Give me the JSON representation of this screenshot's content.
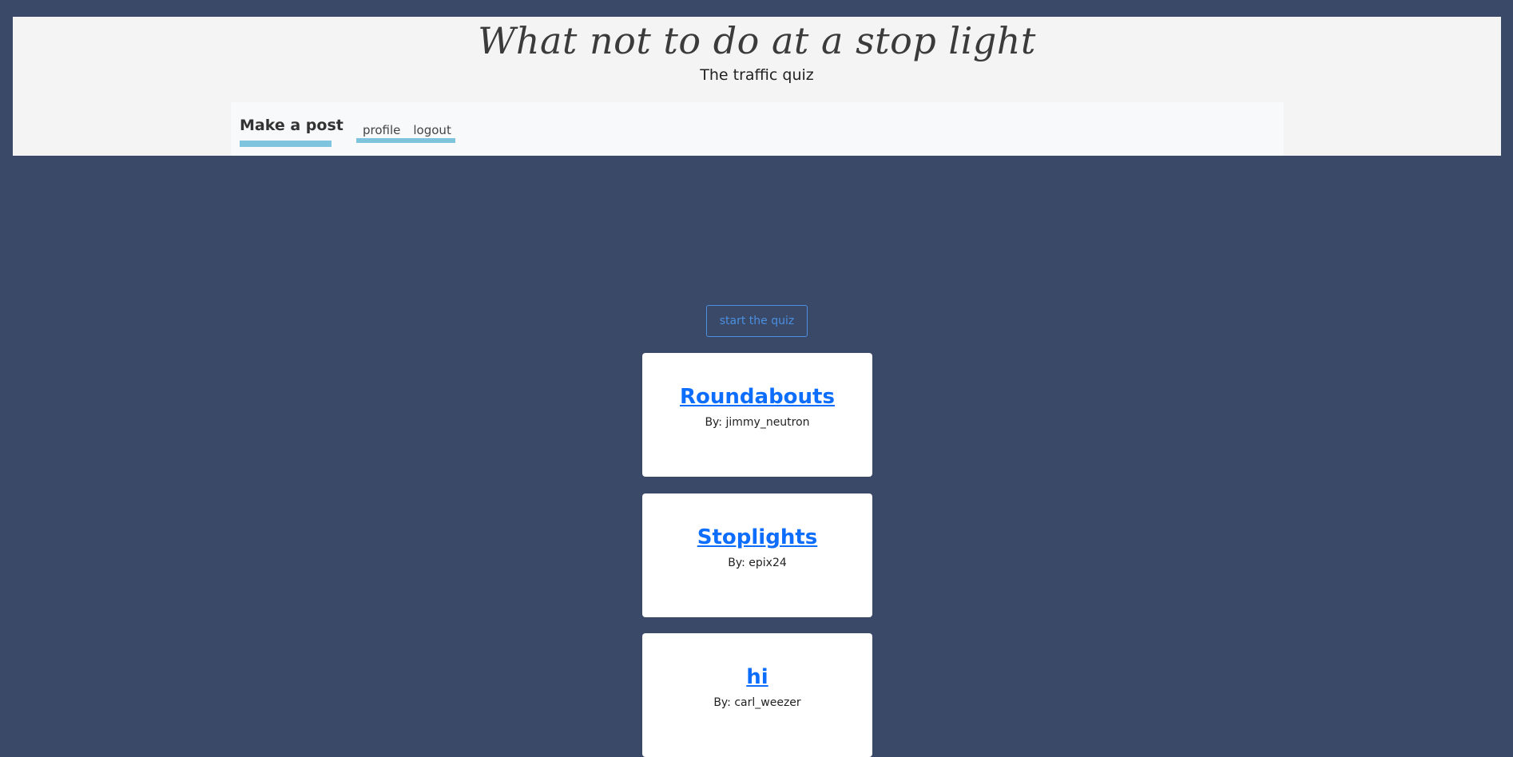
{
  "header": {
    "title": "What not to do at a stop light",
    "subtitle": "The traffic quiz"
  },
  "nav": {
    "brand": "Make a post",
    "links": [
      "profile",
      "logout"
    ],
    "underline_color": "#7ec4de"
  },
  "main": {
    "quiz_button_label": "start the quiz",
    "posts": [
      {
        "title": "Roundabouts",
        "author": "By: jimmy_neutron"
      },
      {
        "title": "Stoplights",
        "author": "By: epix24"
      },
      {
        "title": "hi",
        "author": "By: carl_weezer"
      }
    ]
  },
  "colors": {
    "background": "#3a4968",
    "header_bg": "#f4f4f4",
    "link_blue": "#0d6efd",
    "button_blue": "#4a8fe0"
  }
}
